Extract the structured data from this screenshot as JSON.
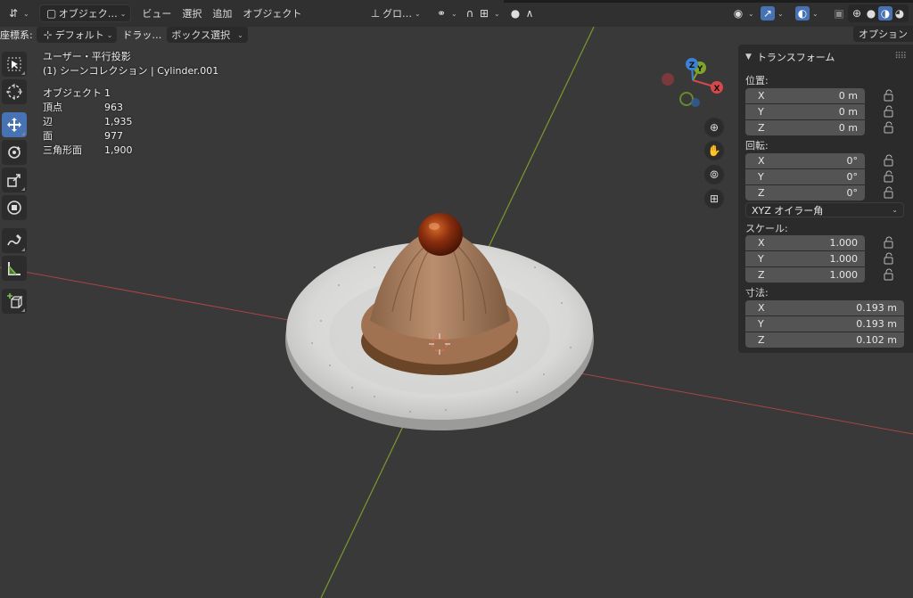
{
  "header": {
    "mode_label": "オブジェク…",
    "menus": [
      "ビュー",
      "選択",
      "追加",
      "オブジェクト"
    ],
    "transform_orientation": "グロ…"
  },
  "toolbar2": {
    "coord_label": "座標系:",
    "orientation_value": "デフォルト",
    "drag_label": "ドラッ…",
    "select_mode": "ボックス選択",
    "options_label": "オプション"
  },
  "overlay": {
    "view_name": "ユーザー・平行投影",
    "collection": "(1) シーンコレクション | Cylinder.001"
  },
  "stats": [
    {
      "label": "オブジェクト",
      "value": "1"
    },
    {
      "label": "頂点",
      "value": "963"
    },
    {
      "label": "辺",
      "value": "1,935"
    },
    {
      "label": "面",
      "value": "977"
    },
    {
      "label": "三角形面",
      "value": "1,900"
    }
  ],
  "gizmo": {
    "x": "X",
    "y": "Y",
    "z": "Z"
  },
  "npanel": {
    "title": "トランスフォーム",
    "location_label": "位置:",
    "location": [
      {
        "axis": "X",
        "value": "0 m"
      },
      {
        "axis": "Y",
        "value": "0 m"
      },
      {
        "axis": "Z",
        "value": "0 m"
      }
    ],
    "rotation_label": "回転:",
    "rotation": [
      {
        "axis": "X",
        "value": "0°"
      },
      {
        "axis": "Y",
        "value": "0°"
      },
      {
        "axis": "Z",
        "value": "0°"
      }
    ],
    "rotation_mode": "XYZ オイラー角",
    "scale_label": "スケール:",
    "scale": [
      {
        "axis": "X",
        "value": "1.000"
      },
      {
        "axis": "Y",
        "value": "1.000"
      },
      {
        "axis": "Z",
        "value": "1.000"
      }
    ],
    "dimensions_label": "寸法:",
    "dimensions": [
      {
        "axis": "X",
        "value": "0.193 m"
      },
      {
        "axis": "Y",
        "value": "0.193 m"
      },
      {
        "axis": "Z",
        "value": "0.102 m"
      }
    ]
  },
  "colors": {
    "accent": "#4772b3",
    "x_axis": "#c04040",
    "y_axis": "#7fa528",
    "z_axis": "#3b82d6"
  }
}
